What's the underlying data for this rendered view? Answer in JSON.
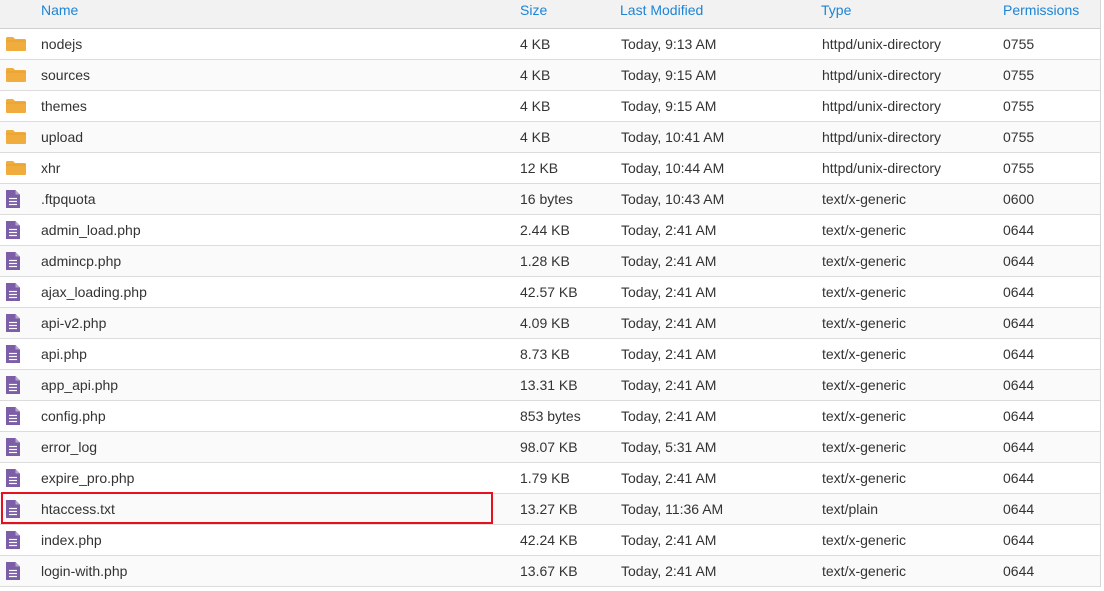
{
  "colors": {
    "header_link": "#1d84d6",
    "folder": "#f0ad3e",
    "file": "#7b5ea7",
    "highlight": "#e8101c"
  },
  "header": {
    "name": "Name",
    "size": "Size",
    "last_modified": "Last Modified",
    "type": "Type",
    "permissions": "Permissions"
  },
  "rows": [
    {
      "icon": "folder-icon",
      "name": "nodejs",
      "size": "4 KB",
      "modified": "Today, 9:13 AM",
      "type": "httpd/unix-directory",
      "perm": "0755"
    },
    {
      "icon": "folder-icon",
      "name": "sources",
      "size": "4 KB",
      "modified": "Today, 9:15 AM",
      "type": "httpd/unix-directory",
      "perm": "0755"
    },
    {
      "icon": "folder-icon",
      "name": "themes",
      "size": "4 KB",
      "modified": "Today, 9:15 AM",
      "type": "httpd/unix-directory",
      "perm": "0755"
    },
    {
      "icon": "folder-icon",
      "name": "upload",
      "size": "4 KB",
      "modified": "Today, 10:41 AM",
      "type": "httpd/unix-directory",
      "perm": "0755"
    },
    {
      "icon": "folder-icon",
      "name": "xhr",
      "size": "12 KB",
      "modified": "Today, 10:44 AM",
      "type": "httpd/unix-directory",
      "perm": "0755"
    },
    {
      "icon": "file-icon",
      "name": ".ftpquota",
      "size": "16 bytes",
      "modified": "Today, 10:43 AM",
      "type": "text/x-generic",
      "perm": "0600"
    },
    {
      "icon": "file-icon",
      "name": "admin_load.php",
      "size": "2.44 KB",
      "modified": "Today, 2:41 AM",
      "type": "text/x-generic",
      "perm": "0644"
    },
    {
      "icon": "file-icon",
      "name": "admincp.php",
      "size": "1.28 KB",
      "modified": "Today, 2:41 AM",
      "type": "text/x-generic",
      "perm": "0644"
    },
    {
      "icon": "file-icon",
      "name": "ajax_loading.php",
      "size": "42.57 KB",
      "modified": "Today, 2:41 AM",
      "type": "text/x-generic",
      "perm": "0644"
    },
    {
      "icon": "file-icon",
      "name": "api-v2.php",
      "size": "4.09 KB",
      "modified": "Today, 2:41 AM",
      "type": "text/x-generic",
      "perm": "0644"
    },
    {
      "icon": "file-icon",
      "name": "api.php",
      "size": "8.73 KB",
      "modified": "Today, 2:41 AM",
      "type": "text/x-generic",
      "perm": "0644"
    },
    {
      "icon": "file-icon",
      "name": "app_api.php",
      "size": "13.31 KB",
      "modified": "Today, 2:41 AM",
      "type": "text/x-generic",
      "perm": "0644"
    },
    {
      "icon": "file-icon",
      "name": "config.php",
      "size": "853 bytes",
      "modified": "Today, 2:41 AM",
      "type": "text/x-generic",
      "perm": "0644"
    },
    {
      "icon": "file-icon",
      "name": "error_log",
      "size": "98.07 KB",
      "modified": "Today, 5:31 AM",
      "type": "text/x-generic",
      "perm": "0644"
    },
    {
      "icon": "file-icon",
      "name": "expire_pro.php",
      "size": "1.79 KB",
      "modified": "Today, 2:41 AM",
      "type": "text/x-generic",
      "perm": "0644"
    },
    {
      "icon": "file-icon",
      "name": "htaccess.txt",
      "size": "13.27 KB",
      "modified": "Today, 11:36 AM",
      "type": "text/plain",
      "perm": "0644"
    },
    {
      "icon": "file-icon",
      "name": "index.php",
      "size": "42.24 KB",
      "modified": "Today, 2:41 AM",
      "type": "text/x-generic",
      "perm": "0644"
    },
    {
      "icon": "file-icon",
      "name": "login-with.php",
      "size": "13.67 KB",
      "modified": "Today, 2:41 AM",
      "type": "text/x-generic",
      "perm": "0644"
    }
  ]
}
